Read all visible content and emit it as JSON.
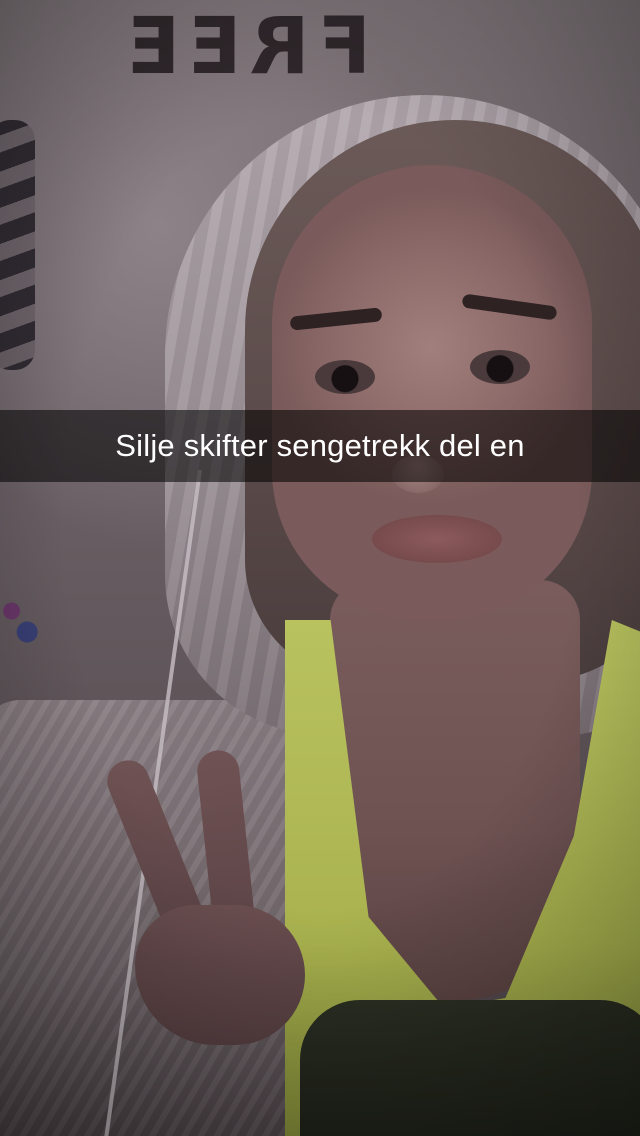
{
  "photo": {
    "wall_text": "FREE",
    "caption": "Silje skifter sengetrekk del en"
  },
  "colors": {
    "caption_bar": "#000000",
    "caption_text": "#ffffff",
    "garment": "#b8c25e"
  }
}
